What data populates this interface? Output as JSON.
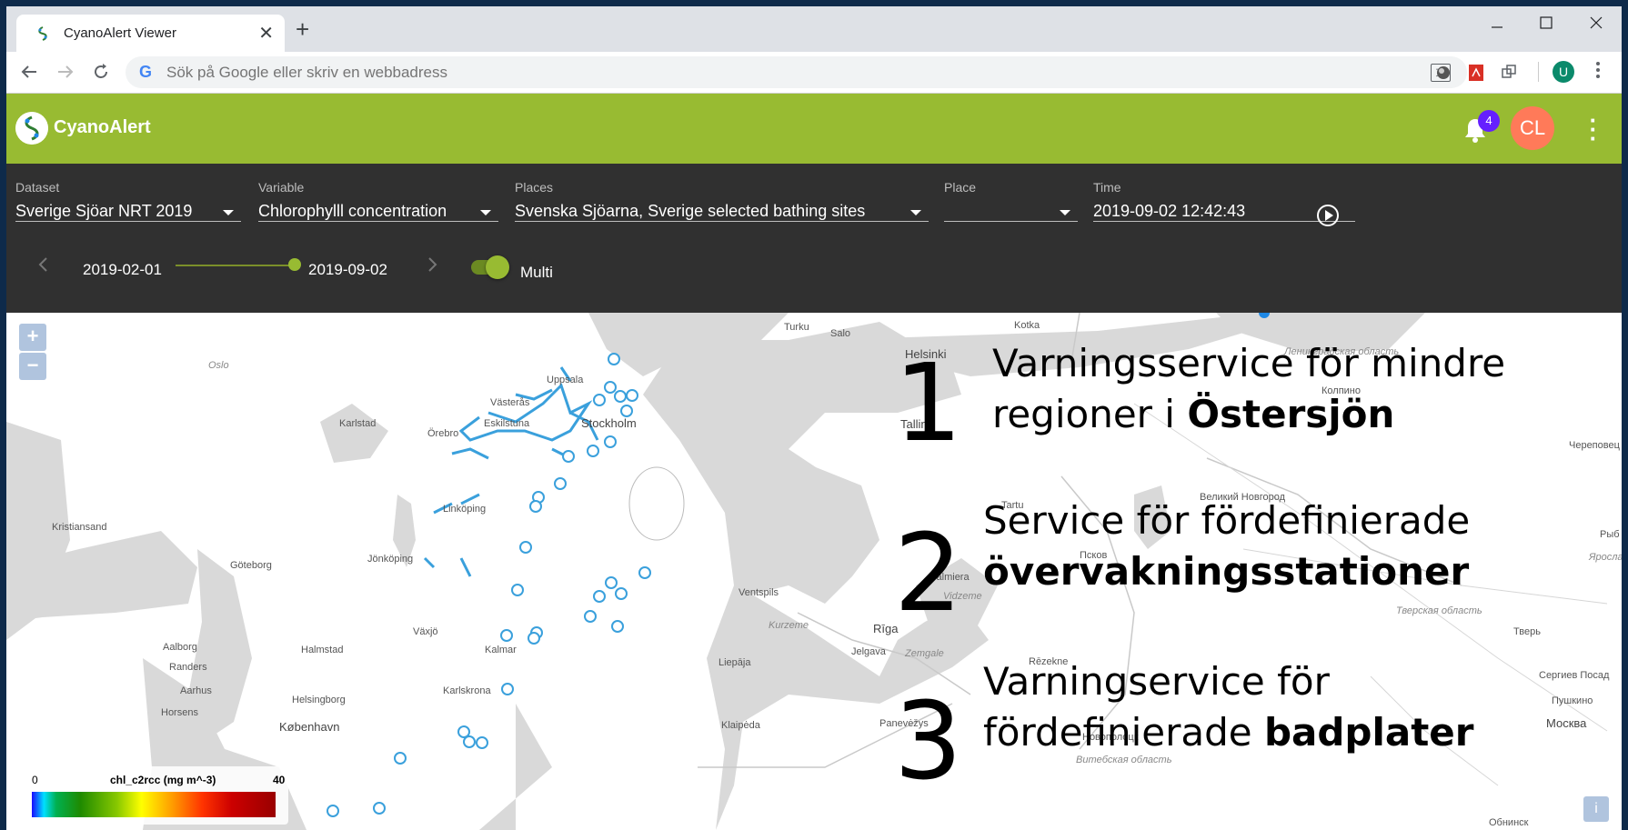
{
  "browser": {
    "tab_title": "CyanoAlert Viewer",
    "tab_close": "✕",
    "new_tab": "+",
    "omnibox_placeholder": "Sök på Google eller skriv en webbadress",
    "profile_initial": "U"
  },
  "app": {
    "title": "CyanoAlert",
    "notifications_count": "4",
    "avatar_initials": "CL"
  },
  "controls": {
    "dataset": {
      "label": "Dataset",
      "value": "Sverige Sjöar NRT 2019"
    },
    "variable": {
      "label": "Variable",
      "value": "Chlorophylll concentration"
    },
    "places": {
      "label": "Places",
      "value": "Svenska Sjöarna, Sverige selected bathing sites"
    },
    "place": {
      "label": "Place",
      "value": ""
    },
    "time": {
      "label": "Time",
      "value": "2019-09-02 12:42:43"
    },
    "range_start": "2019-02-01",
    "range_end": "2019-09-02",
    "multi_label": "Multi",
    "multi_on": true
  },
  "map": {
    "zoom_in": "+",
    "zoom_out": "−",
    "labels": {
      "turku": "Turku",
      "salo": "Salo",
      "kotka": "Kotka",
      "helsinki": "Helsinki",
      "leningrad": "Ленинградская область",
      "kolpino": "Колпино",
      "oslo": "Oslo",
      "uppsala": "Uppsala",
      "vasteras": "Västerås",
      "karlstad": "Karlstad",
      "eskilstuna": "Eskilstuna",
      "orebro": "Örebro",
      "stockholm": "Stockholm",
      "tallinn": "Tallinn",
      "cherepovets": "Череповец",
      "tartu": "Tartu",
      "novgorod": "Великий Новгород",
      "linkoping": "Linköping",
      "kristiansand": "Kristiansand",
      "pskov": "Псков",
      "goteborg": "Göteborg",
      "jonkoping": "Jönköping",
      "valmiera": "Valmiera",
      "vidzeme": "Vidzeme",
      "ventspils": "Ventspils",
      "kurzeme": "Kurzeme",
      "riga": "Rīga",
      "tver_obl": "Тверская область",
      "tver": "Тверь",
      "aalborg": "Aalborg",
      "vaxjo": "Växjö",
      "halmstad": "Halmstad",
      "kalmar": "Kalmar",
      "jelgava": "Jelgava",
      "zemgale": "Zemgale",
      "liepaja": "Liepāja",
      "rezekne": "Rēzekne",
      "randers": "Randers",
      "aarhus": "Aarhus",
      "karlskrona": "Karlskrona",
      "sergiev": "Сергиев Посад",
      "horsens": "Horsens",
      "helsingborg": "Helsingborg",
      "kobenhavn": "København",
      "klaipeda": "Klaipėda",
      "panevezys": "Panevėžys",
      "novopolotsk": "Новополоцк",
      "moskva": "Москва",
      "pushkino": "Пушкино",
      "vitebsk": "Витебская область",
      "obninsk": "Обнинск",
      "fly": "Рыб",
      "yaroslavl": "Яросла"
    }
  },
  "annotations": [
    {
      "num": "1",
      "line1": "Varningsservice för mindre",
      "line2_pre": "regioner i ",
      "line2_bold": "Östersjön"
    },
    {
      "num": "2",
      "line1": "Service för fördefinierade",
      "line2_pre": "",
      "line2_bold": "övervakningsstationer"
    },
    {
      "num": "3",
      "line1": "Varningservice för",
      "line2_pre": "fördefinierade ",
      "line2_bold": "badplater"
    }
  ],
  "legend": {
    "min": "0",
    "name": "chl_c2rcc (mg m^-3)",
    "max": "40"
  },
  "colors": {
    "appbar": "#98bb32",
    "panel": "#303030",
    "markers": "#3aa0dc",
    "badge": "#651fff",
    "avatar": "#ff7a59"
  }
}
